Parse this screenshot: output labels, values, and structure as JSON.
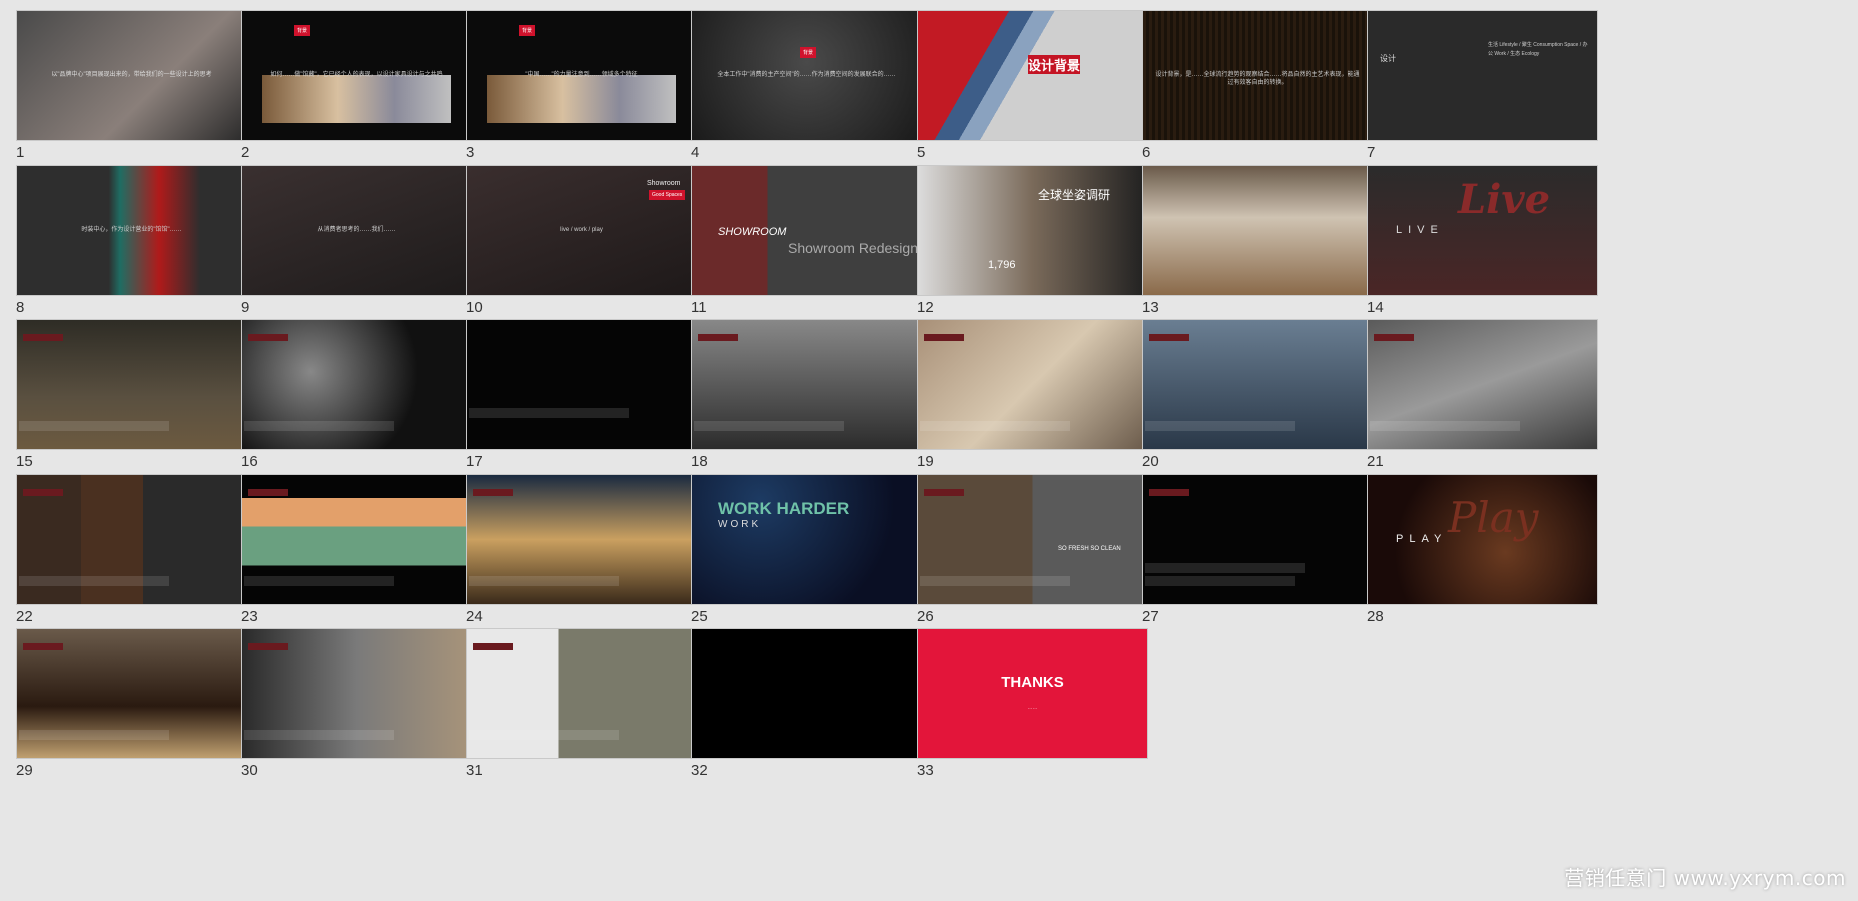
{
  "slides": [
    {
      "number": "1",
      "bg": "#3a3a3a",
      "caption": "以\"品牌中心\"项目展现出来的，带给我们的一些设计上的思考"
    },
    {
      "number": "2",
      "bg": "#0b0b0b",
      "badge": "背景",
      "caption": "如何……做\"馆藏\"，它已经个人的表现，以设计家具设计与之共鸣"
    },
    {
      "number": "3",
      "bg": "#0b0b0b",
      "badge": "背景",
      "caption": "\"中国……\"的力量注意到……领域多个特征"
    },
    {
      "number": "4",
      "bg": "#2d2d2d",
      "badge": "背景",
      "caption": "全本工作中\"消费的主产空间\"的……作为消费空间的发展联合的……"
    },
    {
      "number": "5",
      "bg": "#cfcfcf",
      "title": "设计背景",
      "caption": "……"
    },
    {
      "number": "6",
      "bg": "#1b1510",
      "caption": "设计背景，是……全球流行趋势的观察结合……将品自然的主艺术表现，能通过有效客自由的转换。"
    },
    {
      "number": "7",
      "bg": "#2a2a2a",
      "title": "设计",
      "caption": "生活 Lifestyle / 聚生 Consumption Space / 办公 Work / 生态 Ecology"
    },
    {
      "number": "8",
      "bg": "#2e2e2e",
      "caption": "时装中心，作为设计营业的\"馆馆\"……"
    },
    {
      "number": "9",
      "bg": "#2c2626",
      "caption": "从消费者思考的……我们……"
    },
    {
      "number": "10",
      "bg": "#2a2424",
      "title": "Showroom",
      "badge": "Good Spaces",
      "caption": "live / work / play"
    },
    {
      "number": "11",
      "bg": "#3a3a3a",
      "title": "SHOWROOM",
      "caption": "Showroom Redesign"
    },
    {
      "number": "12",
      "bg": "#141414",
      "title": "全球坐姿调研",
      "caption": "1,796"
    },
    {
      "number": "13",
      "bg": "#a89a8a",
      "caption": ""
    },
    {
      "number": "14",
      "bg": "#3a2a2a",
      "title": "LIVE",
      "caption": "Live"
    },
    {
      "number": "15",
      "bg": "#3b3a33",
      "caption": ""
    },
    {
      "number": "16",
      "bg": "#2b2b2b",
      "caption": ""
    },
    {
      "number": "17",
      "bg": "#050505",
      "caption": ""
    },
    {
      "number": "18",
      "bg": "#555555",
      "caption": ""
    },
    {
      "number": "19",
      "bg": "#8c7a66",
      "caption": ""
    },
    {
      "number": "20",
      "bg": "#3c4a58",
      "caption": ""
    },
    {
      "number": "21",
      "bg": "#4a4a4a",
      "caption": ""
    },
    {
      "number": "22",
      "bg": "#2a2220",
      "caption": ""
    },
    {
      "number": "23",
      "bg": "#050505",
      "caption": ""
    },
    {
      "number": "24",
      "bg": "#2a2015",
      "caption": ""
    },
    {
      "number": "25",
      "bg": "#0c1430",
      "title": "WORK HARDER",
      "caption": "WORK"
    },
    {
      "number": "26",
      "bg": "#2a2a2a",
      "caption": "SO FRESH  SO CLEAN"
    },
    {
      "number": "27",
      "bg": "#050505",
      "caption": ""
    },
    {
      "number": "28",
      "bg": "#2a1512",
      "title": "PLAY",
      "caption": "Play"
    },
    {
      "number": "29",
      "bg": "#2a2018",
      "caption": ""
    },
    {
      "number": "30",
      "bg": "#1c1c1c",
      "caption": ""
    },
    {
      "number": "31",
      "bg": "#050505",
      "caption": ""
    },
    {
      "number": "32",
      "bg": "#000000",
      "caption": ""
    },
    {
      "number": "33",
      "bg": "#e3153a",
      "title": "THANKS",
      "caption": "……"
    }
  ],
  "watermark": "营销任意门 www.yxrym.com",
  "colors": {
    "accent_red": "#d0122c",
    "page_bg": "#e6e6e6"
  }
}
